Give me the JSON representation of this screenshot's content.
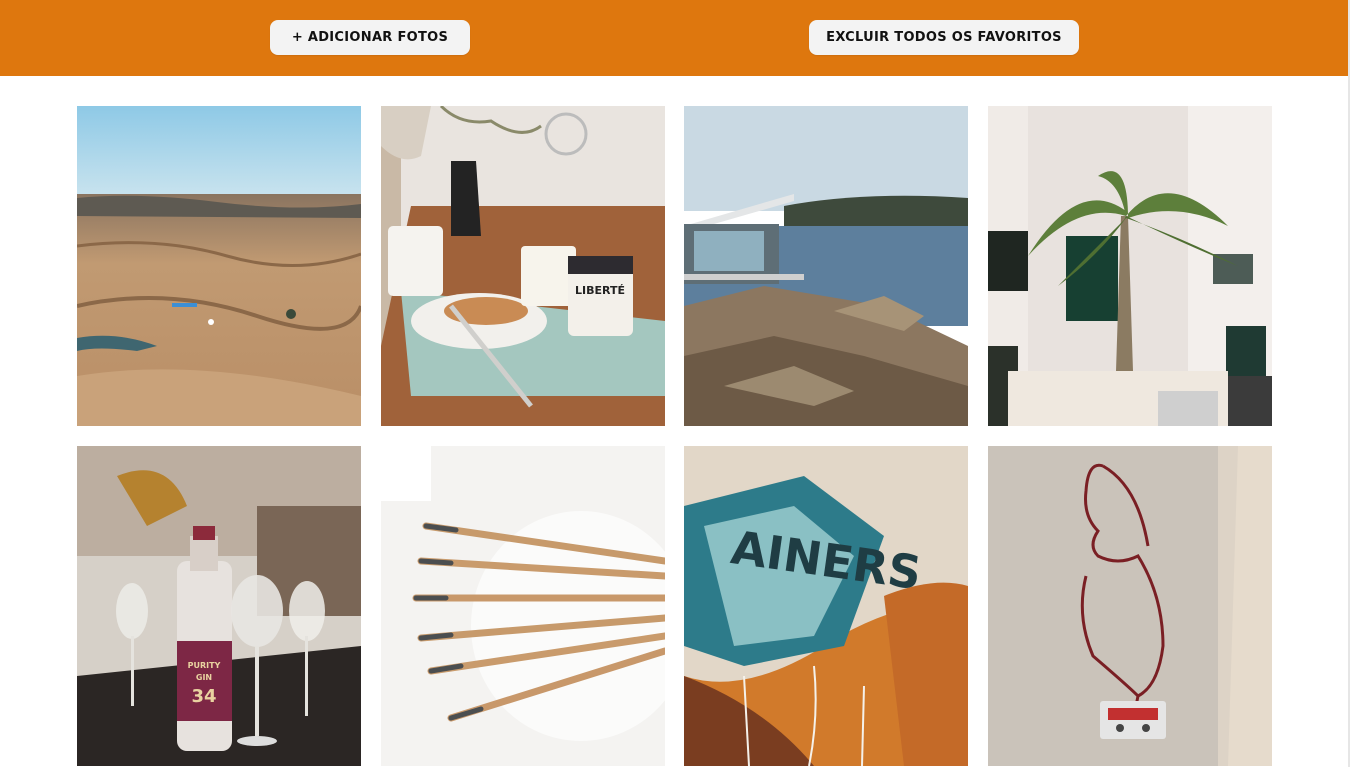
{
  "header": {
    "add_photos_label": "+ ADICIONAR FOTOS",
    "clear_favorites_label": "EXCLUIR TODOS OS FAVORITOS",
    "bar_color": "#de770e"
  },
  "gallery": {
    "photos": [
      {
        "name": "rocky-desert-landscape"
      },
      {
        "name": "breakfast-table-bagels-liberte"
      },
      {
        "name": "coastal-house-on-rocks"
      },
      {
        "name": "palm-tree-white-building"
      },
      {
        "name": "bar-counter-gin-bottle",
        "bottle_text": "PURITY GIN 34"
      },
      {
        "name": "brow-pencils-fan"
      },
      {
        "name": "graffiti-wall",
        "wall_text": "AINERS"
      },
      {
        "name": "wire-sculpture-cassette"
      }
    ]
  }
}
